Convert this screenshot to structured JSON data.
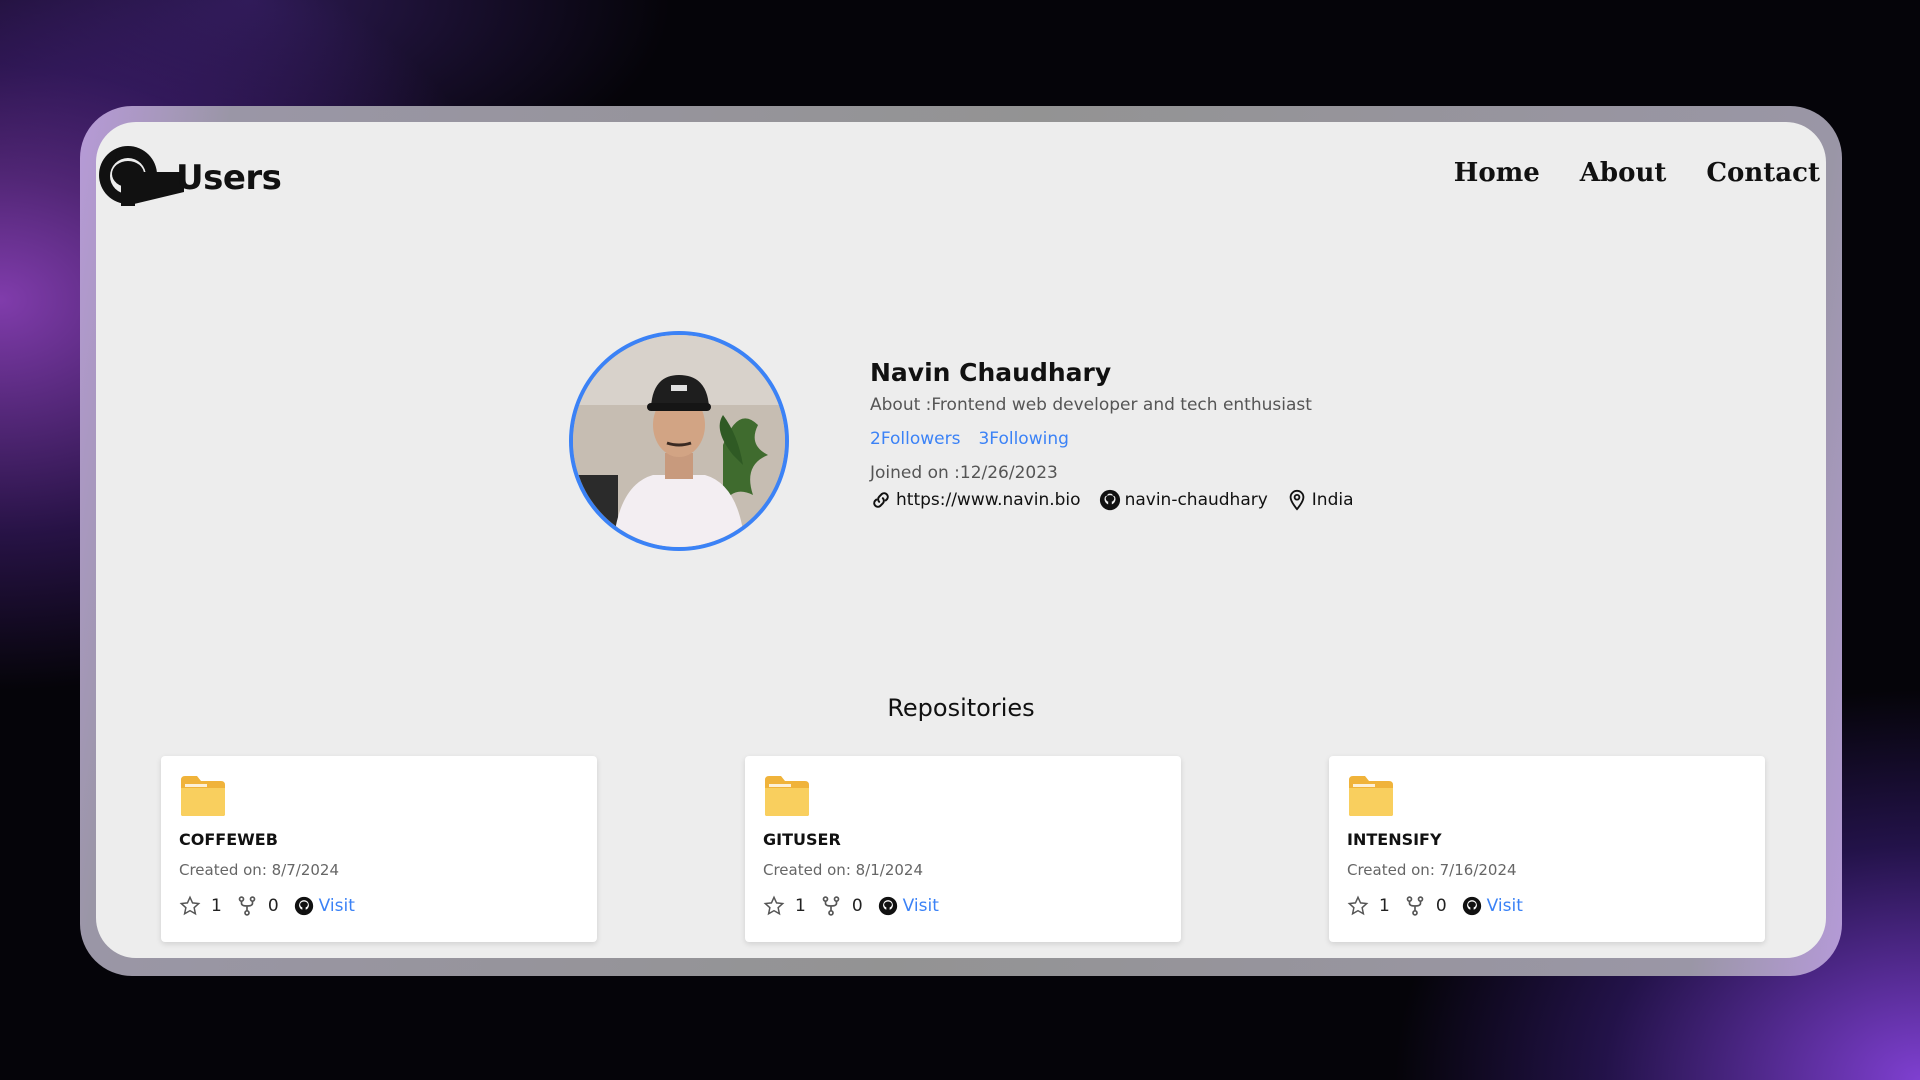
{
  "header": {
    "logo_text": "Users",
    "nav": [
      "Home",
      "About",
      "Contact"
    ]
  },
  "profile": {
    "name": "Navin Chaudhary",
    "about": "About :Frontend web developer and tech enthusiast",
    "followers": "2Followers",
    "following": "3Following",
    "joined": "Joined on :12/26/2023",
    "website": "https://www.navin.bio",
    "username": "navin-chaudhary",
    "location": "India"
  },
  "repositories": {
    "heading": "Repositories",
    "items": [
      {
        "name": "COFFEWEB",
        "created": "Created on: 8/7/2024",
        "stars": "1",
        "forks": "0",
        "visit": "Visit"
      },
      {
        "name": "GITUSER",
        "created": "Created on: 8/1/2024",
        "stars": "1",
        "forks": "0",
        "visit": "Visit"
      },
      {
        "name": "INTENSIFY",
        "created": "Created on: 7/16/2024",
        "stars": "1",
        "forks": "0",
        "visit": "Visit"
      }
    ]
  },
  "colors": {
    "accent": "#3b82f6",
    "folder": "#f7c548",
    "screen_bg": "#ededed"
  }
}
